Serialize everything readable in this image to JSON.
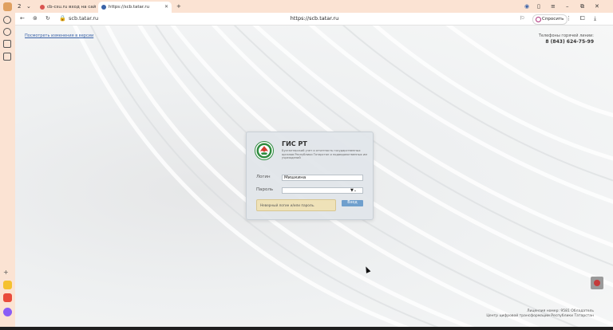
{
  "browser": {
    "tab_count": "2",
    "tabs": [
      {
        "title": "cb-csu.ru вход на сай",
        "active": false,
        "favicon_color": "#d9534f"
      },
      {
        "title": "https://scb.tatar.ru",
        "active": true,
        "favicon_color": "#3a63a8"
      }
    ],
    "new_tab_label": "+",
    "address": {
      "host": "scb.tatar.ru",
      "url": "https://scb.tatar.ru"
    },
    "ask_label": "Спросить",
    "accent": "#fbe3d3"
  },
  "page": {
    "old_version_link": "Посмотреть изменения в версии",
    "hotline": {
      "label": "Телефоны горячей линии:",
      "phone": "8 (843) 624-75-99"
    },
    "footer": {
      "line1": "Лицензия номер: 9581 Обладатель",
      "line2": "Центр цифровой трансформации Республики Татарстан"
    }
  },
  "login": {
    "title": "ГИС РТ",
    "description": "Бухгалтерский учет и отчетность государственных органов Республики Татарстан и подведомственных им учреждений",
    "login_label": "Логин",
    "login_value": "Мишкина",
    "password_label": "Пароль",
    "password_value": "",
    "error_message": "Неверный логин и/или пароль.",
    "submit_label": "Вход",
    "brand_color": "#2e8b3e"
  }
}
